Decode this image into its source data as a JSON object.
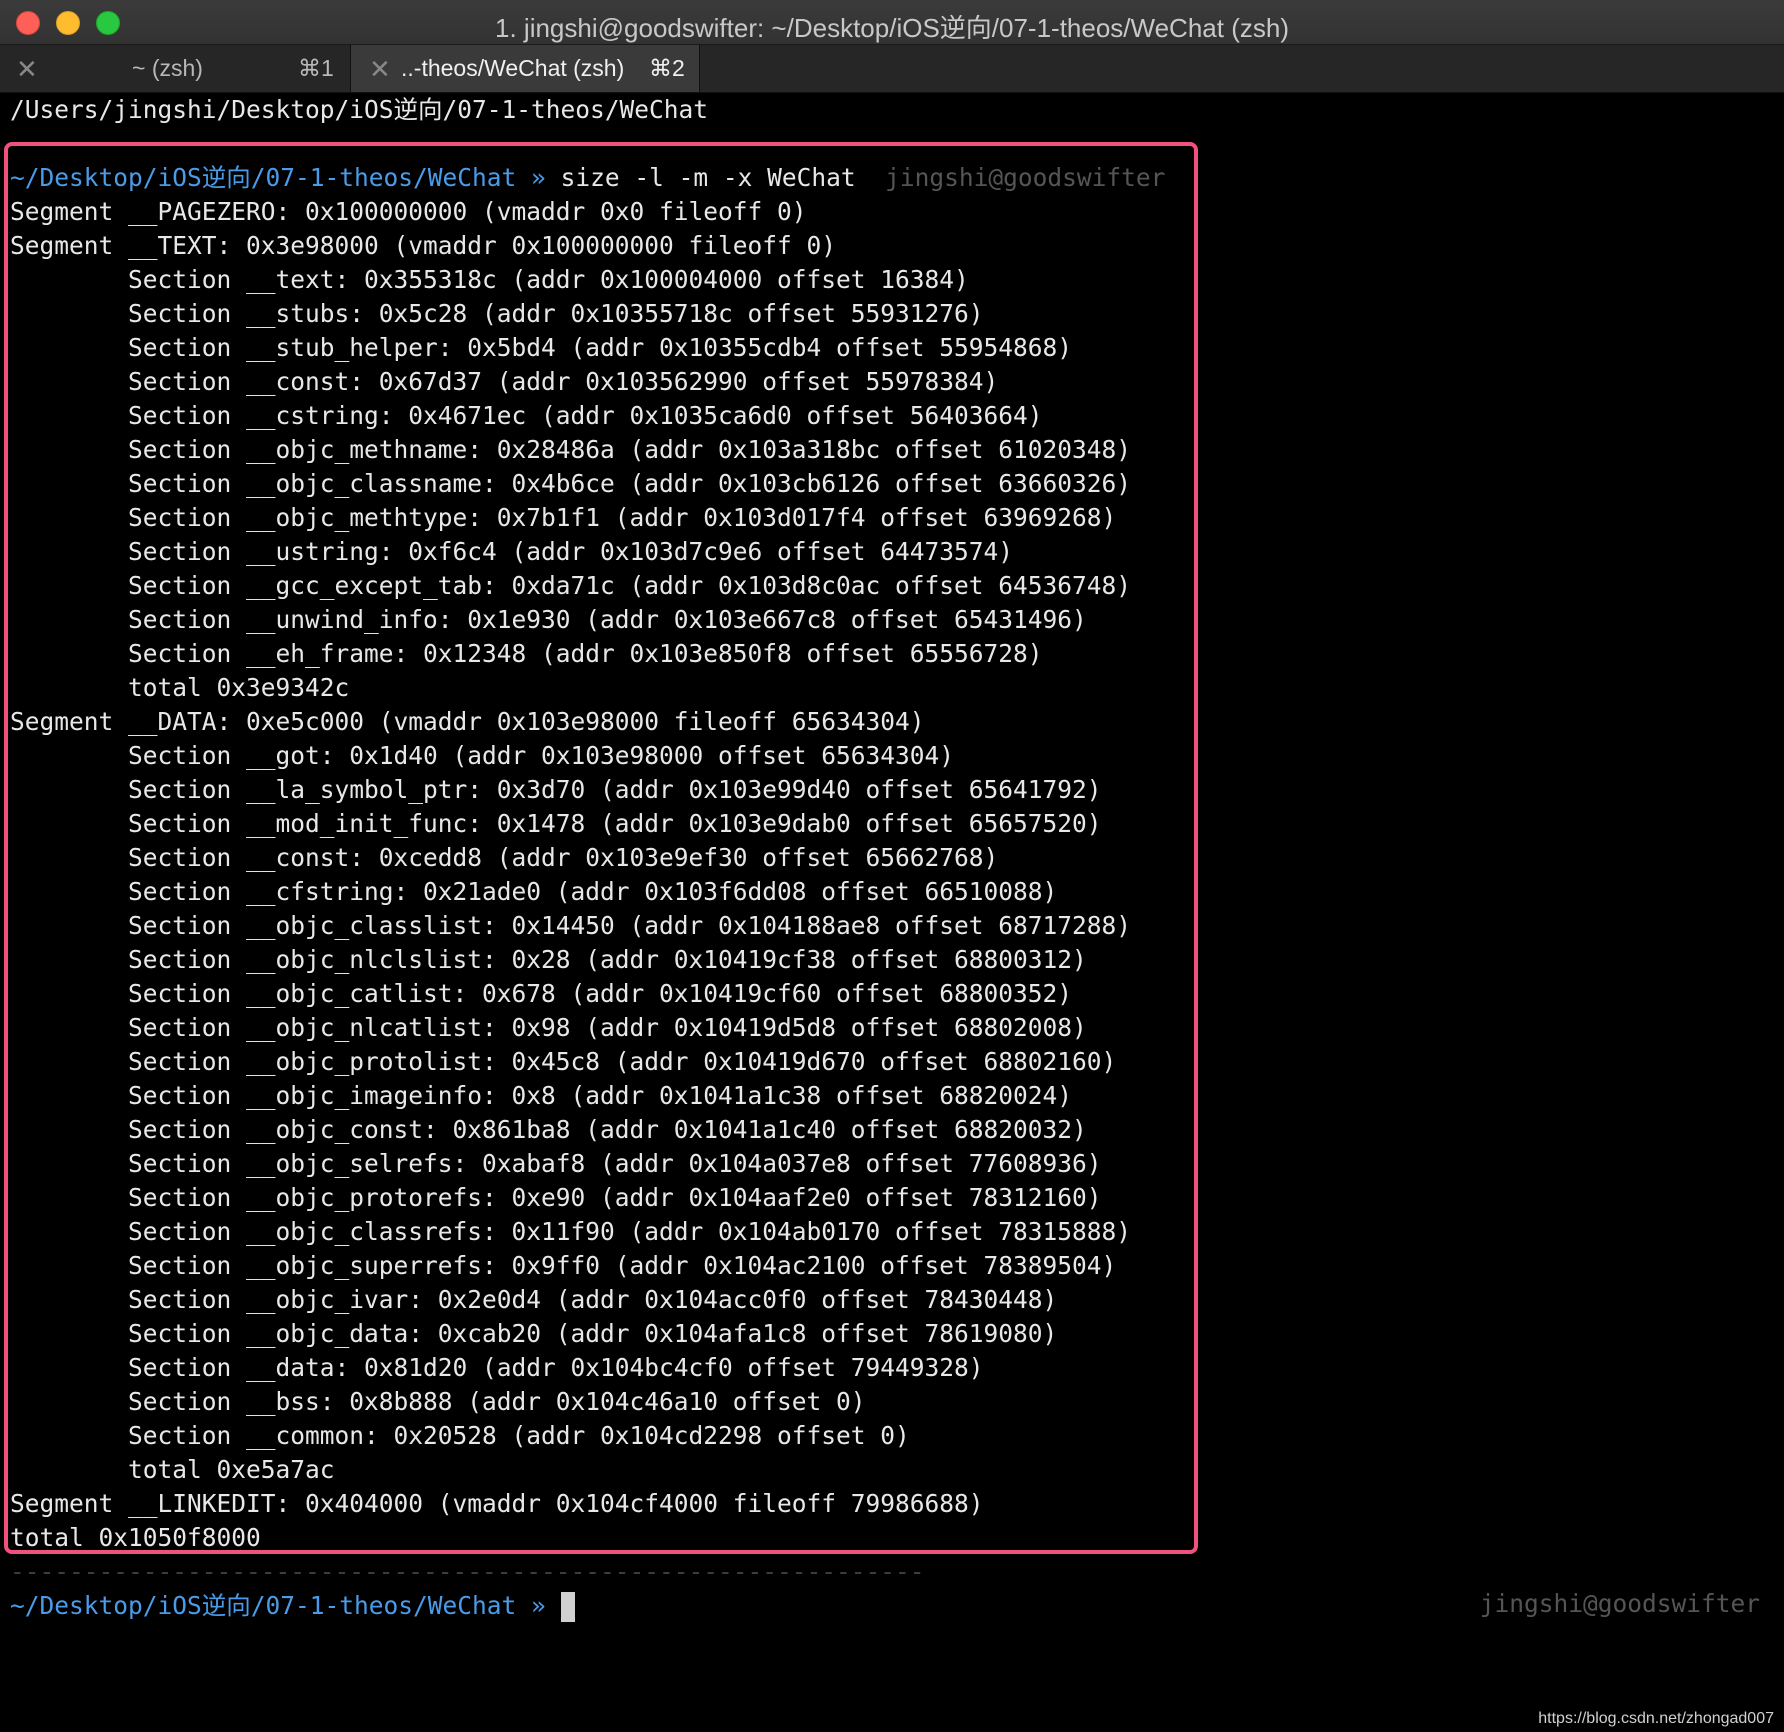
{
  "window": {
    "title": "1. jingshi@goodswifter: ~/Desktop/iOS逆向/07-1-theos/WeChat (zsh)"
  },
  "tabs": [
    {
      "label": "~ (zsh)",
      "shortcut": "⌘1"
    },
    {
      "label": "..-theos/WeChat (zsh)",
      "shortcut": "⌘2"
    }
  ],
  "terminal": {
    "pwd_line": "/Users/jingshi/Desktop/iOS逆向/07-1-theos/WeChat",
    "separator": "--------------------------------------------------------------",
    "prompt_path": "~/Desktop/iOS逆向/07-1-theos/WeChat",
    "prompt_arrow": "»",
    "command": "size -l -m -x WeChat",
    "host": "jingshi@goodswifter",
    "output": [
      "Segment __PAGEZERO: 0x100000000 (vmaddr 0x0 fileoff 0)",
      "Segment __TEXT: 0x3e98000 (vmaddr 0x100000000 fileoff 0)",
      "\tSection __text: 0x355318c (addr 0x100004000 offset 16384)",
      "\tSection __stubs: 0x5c28 (addr 0x10355718c offset 55931276)",
      "\tSection __stub_helper: 0x5bd4 (addr 0x10355cdb4 offset 55954868)",
      "\tSection __const: 0x67d37 (addr 0x103562990 offset 55978384)",
      "\tSection __cstring: 0x4671ec (addr 0x1035ca6d0 offset 56403664)",
      "\tSection __objc_methname: 0x28486a (addr 0x103a318bc offset 61020348)",
      "\tSection __objc_classname: 0x4b6ce (addr 0x103cb6126 offset 63660326)",
      "\tSection __objc_methtype: 0x7b1f1 (addr 0x103d017f4 offset 63969268)",
      "\tSection __ustring: 0xf6c4 (addr 0x103d7c9e6 offset 64473574)",
      "\tSection __gcc_except_tab: 0xda71c (addr 0x103d8c0ac offset 64536748)",
      "\tSection __unwind_info: 0x1e930 (addr 0x103e667c8 offset 65431496)",
      "\tSection __eh_frame: 0x12348 (addr 0x103e850f8 offset 65556728)",
      "\ttotal 0x3e9342c",
      "Segment __DATA: 0xe5c000 (vmaddr 0x103e98000 fileoff 65634304)",
      "\tSection __got: 0x1d40 (addr 0x103e98000 offset 65634304)",
      "\tSection __la_symbol_ptr: 0x3d70 (addr 0x103e99d40 offset 65641792)",
      "\tSection __mod_init_func: 0x1478 (addr 0x103e9dab0 offset 65657520)",
      "\tSection __const: 0xcedd8 (addr 0x103e9ef30 offset 65662768)",
      "\tSection __cfstring: 0x21ade0 (addr 0x103f6dd08 offset 66510088)",
      "\tSection __objc_classlist: 0x14450 (addr 0x104188ae8 offset 68717288)",
      "\tSection __objc_nlclslist: 0x28 (addr 0x10419cf38 offset 68800312)",
      "\tSection __objc_catlist: 0x678 (addr 0x10419cf60 offset 68800352)",
      "\tSection __objc_nlcatlist: 0x98 (addr 0x10419d5d8 offset 68802008)",
      "\tSection __objc_protolist: 0x45c8 (addr 0x10419d670 offset 68802160)",
      "\tSection __objc_imageinfo: 0x8 (addr 0x1041a1c38 offset 68820024)",
      "\tSection __objc_const: 0x861ba8 (addr 0x1041a1c40 offset 68820032)",
      "\tSection __objc_selrefs: 0xabaf8 (addr 0x104a037e8 offset 77608936)",
      "\tSection __objc_protorefs: 0xe90 (addr 0x104aaf2e0 offset 78312160)",
      "\tSection __objc_classrefs: 0x11f90 (addr 0x104ab0170 offset 78315888)",
      "\tSection __objc_superrefs: 0x9ff0 (addr 0x104ac2100 offset 78389504)",
      "\tSection __objc_ivar: 0x2e0d4 (addr 0x104acc0f0 offset 78430448)",
      "\tSection __objc_data: 0xcab20 (addr 0x104afa1c8 offset 78619080)",
      "\tSection __data: 0x81d20 (addr 0x104bc4cf0 offset 79449328)",
      "\tSection __bss: 0x8b888 (addr 0x104c46a10 offset 0)",
      "\tSection __common: 0x20528 (addr 0x104cd2298 offset 0)",
      "\ttotal 0xe5a7ac",
      "Segment __LINKEDIT: 0x404000 (vmaddr 0x104cf4000 fileoff 79986688)",
      "total 0x1050f8000"
    ]
  },
  "highlight_color": "#f2507d",
  "watermark": "https://blog.csdn.net/zhongad007"
}
